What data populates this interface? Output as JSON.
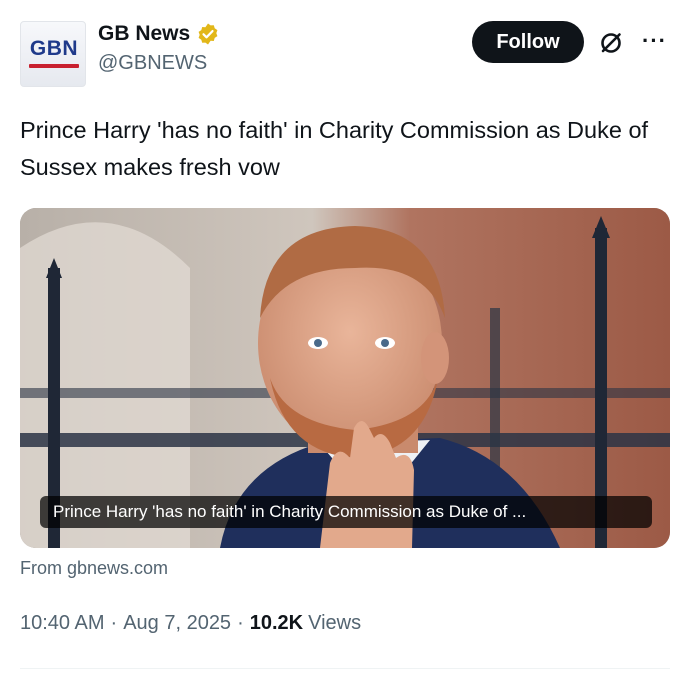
{
  "account": {
    "avatar_text": "GBN",
    "display_name": "GB News",
    "handle": "@GBNEWS",
    "verified_color": "#e2b719"
  },
  "actions": {
    "follow_label": "Follow",
    "grok_icon": "grok-icon",
    "more_icon": "more-icon"
  },
  "tweet": {
    "text": "Prince Harry 'has no faith' in Charity Commission as Duke of Sussex makes fresh vow"
  },
  "media": {
    "caption": "Prince Harry 'has no faith' in Charity Commission as Duke of ...",
    "source": "From gbnews.com"
  },
  "meta": {
    "time": "10:40 AM",
    "date": "Aug 7, 2025",
    "views_count": "10.2K",
    "views_label": "Views"
  },
  "colors": {
    "text": "#0f1419",
    "secondary": "#536471",
    "follow_bg": "#0f1419",
    "gbn_blue": "#1f3a8a",
    "gbn_red": "#c8202f"
  }
}
